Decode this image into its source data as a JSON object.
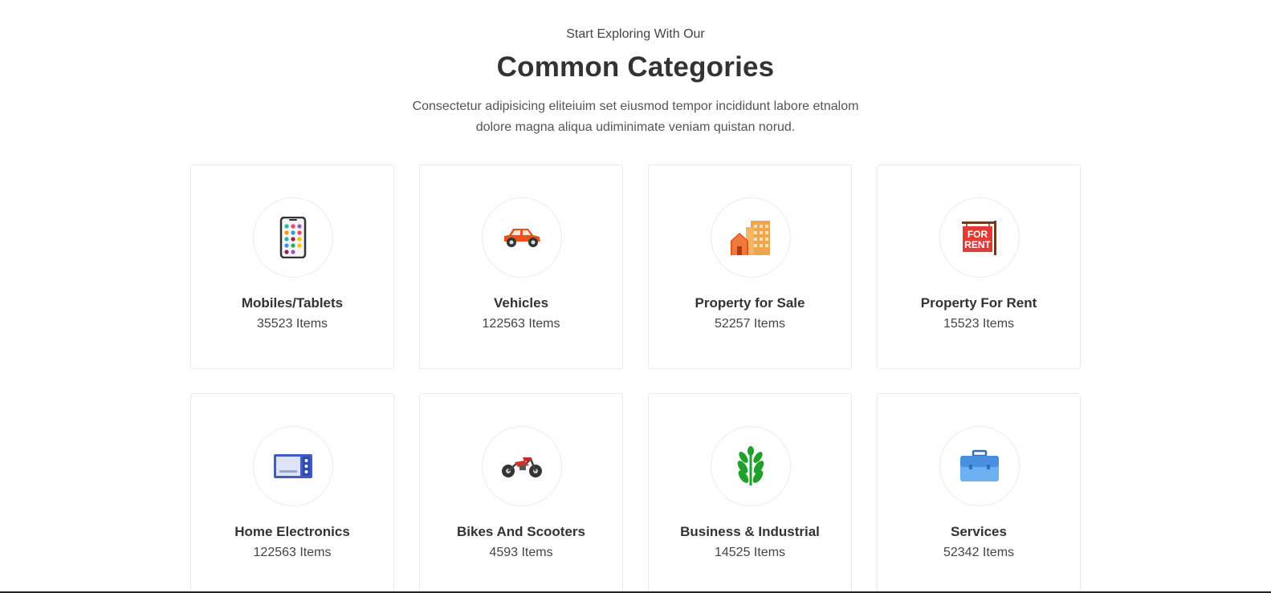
{
  "header": {
    "kicker": "Start Exploring With Our",
    "title": "Common Categories",
    "description": "Consectetur adipisicing eliteiuim set eiusmod tempor incididunt labore etnalom dolore magna aliqua udiminimate veniam quistan norud."
  },
  "categories": [
    {
      "name": "Mobiles/Tablets",
      "count": "35523 Items",
      "icon": "mobile-phone-icon"
    },
    {
      "name": "Vehicles",
      "count": "122563 Items",
      "icon": "car-icon"
    },
    {
      "name": "Property for Sale",
      "count": "52257 Items",
      "icon": "buildings-icon"
    },
    {
      "name": "Property For Rent",
      "count": "15523 Items",
      "icon": "for-rent-sign-icon"
    },
    {
      "name": "Home Electronics",
      "count": "122563 Items",
      "icon": "microwave-icon"
    },
    {
      "name": "Bikes And Scooters",
      "count": "4593 Items",
      "icon": "motorbike-icon"
    },
    {
      "name": "Business & Industrial",
      "count": "14525 Items",
      "icon": "plant-icon"
    },
    {
      "name": "Services",
      "count": "52342 Items",
      "icon": "briefcase-icon"
    }
  ],
  "sign": {
    "line1": "FOR",
    "line2": "RENT"
  },
  "colors": {
    "text_dark": "#333333",
    "border": "#ebebeb",
    "car": "#e8521b",
    "building": "#f0a54a",
    "sign": "#e53935",
    "microwave": "#3f5bc4",
    "plant": "#1fa02a",
    "briefcase": "#4a90e2"
  }
}
